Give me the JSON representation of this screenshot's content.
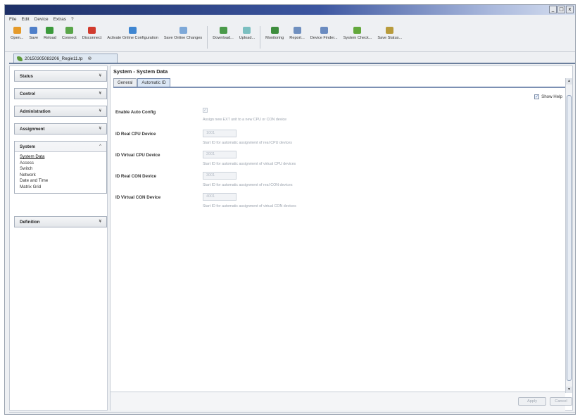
{
  "window": {
    "controls": [
      "_",
      "□",
      "x"
    ]
  },
  "menu": [
    "File",
    "Edit",
    "Device",
    "Extras",
    "?"
  ],
  "toolbar": {
    "colors": [
      "#e59a2a",
      "#4f7fc9",
      "#3c9a3c",
      "#5aa64a",
      "#d13b2e",
      "#3f86d1",
      "#7da8d8",
      "#4a9a4a",
      "#7bbfc0",
      "#3d8d3d",
      "#6f8fbf",
      "#6a8bc0",
      "#63a83c",
      "#b89b3c"
    ],
    "buttons": [
      "Open...",
      "Save",
      "Reload",
      "Connect",
      "Disconnect",
      "Activate Online Configuration",
      "Save Online Changes",
      "Download...",
      "Upload...",
      "Monitoring",
      "Report...",
      "Device Finder...",
      "System Check...",
      "Save Status..."
    ]
  },
  "doc_tab": {
    "name": "20150305083206_Regie11.tp",
    "close": "⊗"
  },
  "nav": {
    "sections": [
      {
        "title": "Status",
        "chevron": "¥"
      },
      {
        "title": "Control",
        "chevron": "¥"
      },
      {
        "title": "Administration",
        "chevron": "¥"
      },
      {
        "title": "Assignment",
        "chevron": "¥"
      },
      {
        "title": "System",
        "chevron": "^",
        "items": [
          "System Data",
          "Access",
          "Switch",
          "Network",
          "Date and Time",
          "Matrix Grid"
        ]
      },
      {
        "title": "Definition",
        "chevron": "¥"
      }
    ]
  },
  "main": {
    "title": "System - System Data",
    "tabs": [
      "General",
      "Automatic ID"
    ],
    "show_help": "Show Help",
    "show_help_checked": true,
    "fields": [
      {
        "label": "Enable Auto Config",
        "type": "checkbox",
        "checked": true,
        "help": "Assign new EXT unit to a new CPU or CON device"
      },
      {
        "label": "ID Real CPU Device",
        "type": "input",
        "value": "1001",
        "help": "Start ID for automatic assignment of real CPU devices"
      },
      {
        "label": "ID Virtual CPU Device",
        "type": "input",
        "value": "2001",
        "help": "Start ID for automatic assignment of virtual CPU devices"
      },
      {
        "label": "ID Real CON Device",
        "type": "input",
        "value": "3001",
        "help": "Start ID for automatic assignment of real CON devices"
      },
      {
        "label": "ID Virtual CON Device",
        "type": "input",
        "value": "4001",
        "help": "Start ID for automatic assignment of virtual CON devices"
      }
    ],
    "apply": "Apply",
    "cancel": "Cancel",
    "scroll_up": "▲",
    "scroll_down": "▼"
  }
}
